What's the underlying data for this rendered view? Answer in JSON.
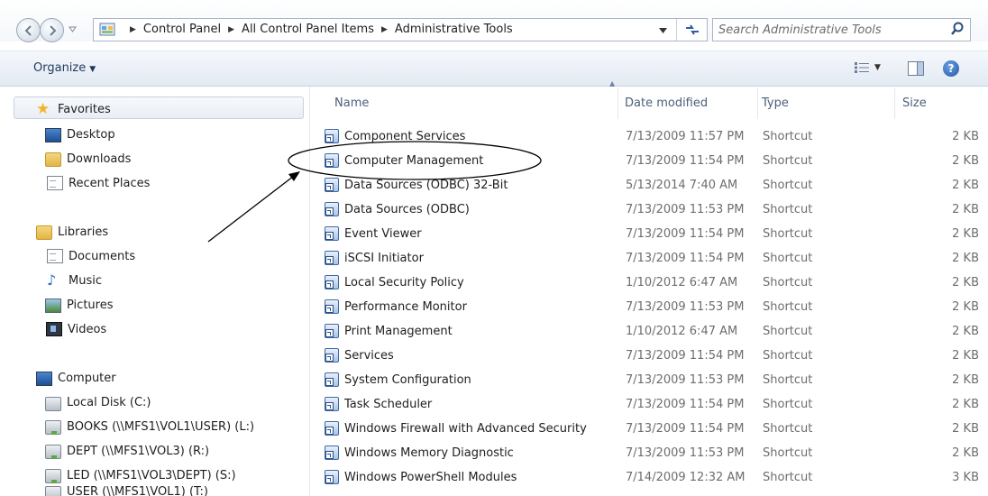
{
  "address": {
    "crumbs": [
      "Control Panel",
      "All Control Panel Items",
      "Administrative Tools"
    ]
  },
  "search": {
    "placeholder": "Search Administrative Tools"
  },
  "toolbar": {
    "organize_label": "Organize"
  },
  "nav": {
    "favorites": {
      "label": "Favorites",
      "items": [
        "Desktop",
        "Downloads",
        "Recent Places"
      ]
    },
    "libraries": {
      "label": "Libraries",
      "items": [
        "Documents",
        "Music",
        "Pictures",
        "Videos"
      ]
    },
    "computer": {
      "label": "Computer",
      "items": [
        "Local Disk (C:)",
        "BOOKS (\\\\MFS1\\VOL1\\USER) (L:)",
        "DEPT (\\\\MFS1\\VOL3) (R:)",
        "LED (\\\\MFS1\\VOL3\\DEPT) (S:)",
        "USER (\\\\MFS1\\VOL1) (T:)"
      ]
    }
  },
  "columns": {
    "name": "Name",
    "date": "Date modified",
    "type": "Type",
    "size": "Size"
  },
  "files": [
    {
      "name": "Component Services",
      "date": "7/13/2009 11:57 PM",
      "type": "Shortcut",
      "size": "2 KB"
    },
    {
      "name": "Computer Management",
      "date": "7/13/2009 11:54 PM",
      "type": "Shortcut",
      "size": "2 KB"
    },
    {
      "name": "Data Sources (ODBC) 32-Bit",
      "date": "5/13/2014 7:40 AM",
      "type": "Shortcut",
      "size": "2 KB"
    },
    {
      "name": "Data Sources (ODBC)",
      "date": "7/13/2009 11:53 PM",
      "type": "Shortcut",
      "size": "2 KB"
    },
    {
      "name": "Event Viewer",
      "date": "7/13/2009 11:54 PM",
      "type": "Shortcut",
      "size": "2 KB"
    },
    {
      "name": "iSCSI Initiator",
      "date": "7/13/2009 11:54 PM",
      "type": "Shortcut",
      "size": "2 KB"
    },
    {
      "name": "Local Security Policy",
      "date": "1/10/2012 6:47 AM",
      "type": "Shortcut",
      "size": "2 KB"
    },
    {
      "name": "Performance Monitor",
      "date": "7/13/2009 11:53 PM",
      "type": "Shortcut",
      "size": "2 KB"
    },
    {
      "name": "Print Management",
      "date": "1/10/2012 6:47 AM",
      "type": "Shortcut",
      "size": "2 KB"
    },
    {
      "name": "Services",
      "date": "7/13/2009 11:54 PM",
      "type": "Shortcut",
      "size": "2 KB"
    },
    {
      "name": "System Configuration",
      "date": "7/13/2009 11:53 PM",
      "type": "Shortcut",
      "size": "2 KB"
    },
    {
      "name": "Task Scheduler",
      "date": "7/13/2009 11:54 PM",
      "type": "Shortcut",
      "size": "2 KB"
    },
    {
      "name": "Windows Firewall with Advanced Security",
      "date": "7/13/2009 11:54 PM",
      "type": "Shortcut",
      "size": "2 KB"
    },
    {
      "name": "Windows Memory Diagnostic",
      "date": "7/13/2009 11:53 PM",
      "type": "Shortcut",
      "size": "2 KB"
    },
    {
      "name": "Windows PowerShell Modules",
      "date": "7/14/2009 12:32 AM",
      "type": "Shortcut",
      "size": "3 KB"
    }
  ],
  "colors": {
    "header_text": "#4c607a",
    "meta_text": "#6d6d6d",
    "toolbar_text": "#1e395b",
    "annotation": "#000000"
  }
}
